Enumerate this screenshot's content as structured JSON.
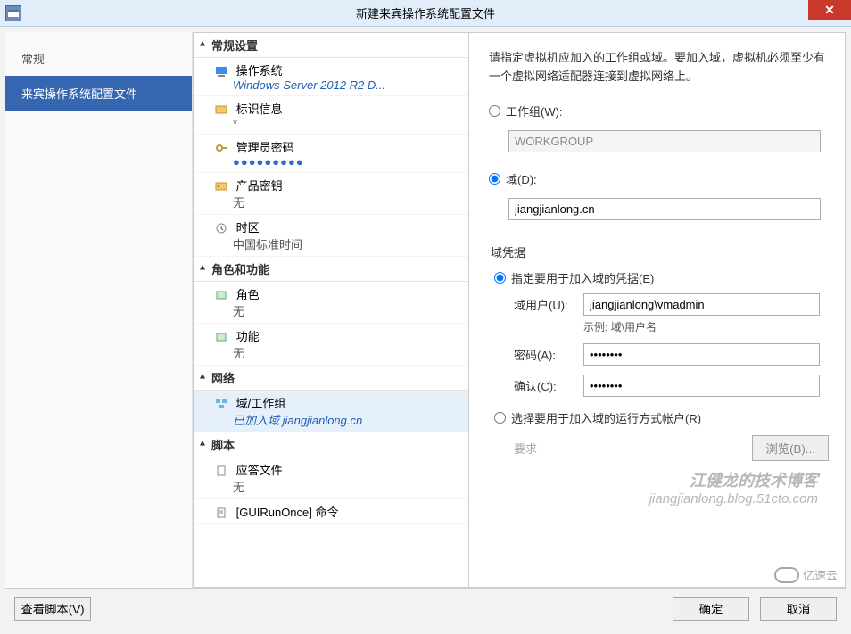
{
  "title": "新建来宾操作系统配置文件",
  "leftNav": {
    "general": "常规",
    "guestProfile": "来宾操作系统配置文件"
  },
  "tree": {
    "sec1": "常规设置",
    "os_label": "操作系统",
    "os_value": "Windows Server 2012 R2 D...",
    "id_label": "标识信息",
    "id_value": "*",
    "pwd_label": "管理员密码",
    "pwd_value": "●●●●●●●●●",
    "key_label": "产品密钥",
    "key_value": "无",
    "tz_label": "时区",
    "tz_value": "中国标准时间",
    "sec2": "角色和功能",
    "roles_label": "角色",
    "roles_value": "无",
    "feat_label": "功能",
    "feat_value": "无",
    "sec3": "网络",
    "domain_label": "域/工作组",
    "domain_value": "已加入域 jiangjianlong.cn",
    "sec4": "脚本",
    "ans_label": "应答文件",
    "ans_value": "无",
    "gui_label": "[GUIRunOnce] 命令"
  },
  "right": {
    "description": "请指定虚拟机应加入的工作组或域。要加入域，虚拟机必须至少有一个虚拟网络适配器连接到虚拟网络上。",
    "workgroup_label": "工作组(W):",
    "workgroup_value": "WORKGROUP",
    "domain_label": "域(D):",
    "domain_value": "jiangjianlong.cn",
    "cred_group": "域凭据",
    "spec_cred_label": "指定要用于加入域的凭据(E)",
    "user_label": "域用户(U):",
    "user_value": "jiangjianlong\\vmadmin",
    "user_hint": "示例: 域\\用户名",
    "pwd_label": "密码(A):",
    "pwd_value": "••••••••",
    "confirm_label": "确认(C):",
    "confirm_value": "••••••••",
    "runas_label": "选择要用于加入域的运行方式帐户(R)",
    "req": "要求",
    "browse": "浏览(B)..."
  },
  "footer": {
    "viewScript": "查看脚本(V)",
    "ok": "确定",
    "cancel": "取消"
  },
  "watermark": {
    "l1": "江健龙的技术博客",
    "l2": "jiangjianlong.blog.51cto.com",
    "logo": "亿速云"
  }
}
